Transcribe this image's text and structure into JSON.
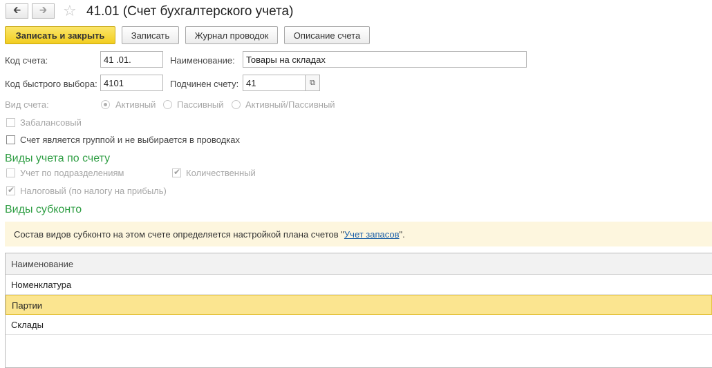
{
  "window": {
    "title": "41.01 (Счет бухгалтерского учета)"
  },
  "nav": {
    "back_icon": "arrow-left-icon",
    "forward_icon": "arrow-right-icon",
    "favorite_icon": "star-icon"
  },
  "toolbar": {
    "save_close_label": "Записать и закрыть",
    "save_label": "Записать",
    "journal_label": "Журнал проводок",
    "description_label": "Описание счета"
  },
  "form": {
    "code_label": "Код счета:",
    "code_value": "41 .01.",
    "name_label": "Наименование:",
    "name_value": "Товары на складах",
    "quick_code_label": "Код быстрого выбора:",
    "quick_code_value": "4101",
    "parent_label": "Подчинен счету:",
    "parent_value": "41",
    "type_label": "Вид счета:",
    "type_options": [
      "Активный",
      "Пассивный",
      "Активный/Пассивный"
    ],
    "type_selected": "Активный",
    "offbalance_label": "Забалансовый",
    "offbalance_checked": false,
    "group_label": "Счет является группой и не выбирается в проводках",
    "group_checked": false
  },
  "accounting_types": {
    "heading": "Виды учета по счету",
    "by_department_label": "Учет по подразделениям",
    "by_department_checked": false,
    "quantitative_label": "Количественный",
    "quantitative_checked": true,
    "tax_label": "Налоговый (по налогу на прибыль)",
    "tax_checked": true
  },
  "subconto": {
    "heading": "Виды субконто",
    "info_prefix": "Состав видов субконто на этом счете определяется настройкой плана счетов \"",
    "info_link": "Учет запасов",
    "info_suffix": "\".",
    "column_header": "Наименование",
    "rows": [
      "Номенклатура",
      "Партии",
      "Склады"
    ],
    "selected_row": "Партии"
  },
  "colors": {
    "accent_button": "#f2cd1f",
    "section_heading": "#2f9e44",
    "info_background": "#fdf6de",
    "selected_row": "#fbe590",
    "link": "#1a5fa8"
  }
}
